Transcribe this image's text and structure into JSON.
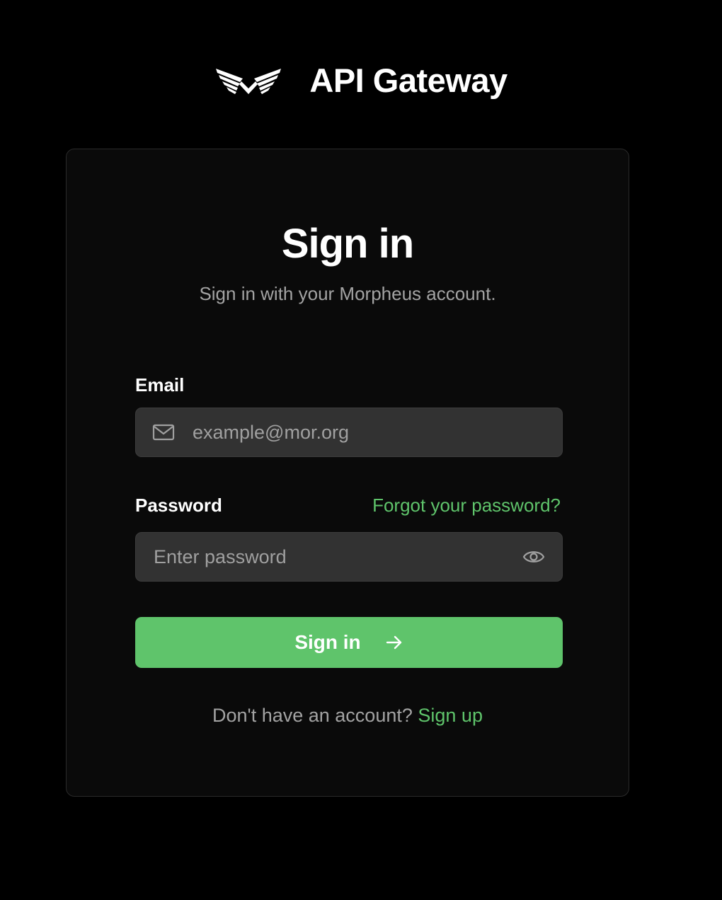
{
  "header": {
    "logo_icon": "morpheus-wings-logo-icon",
    "title": "API Gateway"
  },
  "card": {
    "title": "Sign in",
    "subtitle": "Sign in with your Morpheus account."
  },
  "email": {
    "label": "Email",
    "icon": "mail-icon",
    "value": "",
    "placeholder": "example@mor.org"
  },
  "password": {
    "label": "Password",
    "forgot_link": "Forgot your password?",
    "value": "",
    "placeholder": "Enter password",
    "toggle_icon": "eye-icon"
  },
  "submit": {
    "label": "Sign in",
    "icon": "arrow-right-icon"
  },
  "signup": {
    "prompt": "Don't have an account?",
    "link": "Sign up"
  },
  "colors": {
    "background": "#000000",
    "card": "#0a0a0a",
    "input": "#323232",
    "accent": "#5fc46b",
    "muted_text": "#a3a3a3"
  }
}
